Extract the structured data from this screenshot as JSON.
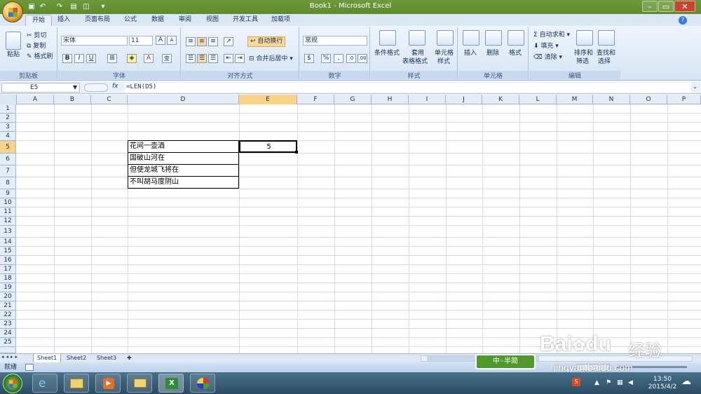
{
  "window": {
    "title": "Book1 - Microsoft Excel"
  },
  "tabs": [
    "开始",
    "插入",
    "页面布局",
    "公式",
    "数据",
    "审阅",
    "视图",
    "开发工具",
    "加载项"
  ],
  "ribbon": {
    "clipboard": {
      "paste": "粘贴",
      "cut": "剪切",
      "copy": "复制",
      "format_painter": "格式刷",
      "label": "剪贴板"
    },
    "font": {
      "name": "宋体",
      "size": "11",
      "bold": "B",
      "italic": "I",
      "underline": "U",
      "grow": "A",
      "shrink": "A",
      "font_color": "A",
      "pinyin": "变",
      "label": "字体"
    },
    "alignment": {
      "wrap": "自动换行",
      "merge": "合并后居中",
      "label": "对齐方式"
    },
    "number": {
      "format": "常规",
      "percent": "%",
      "comma": ",",
      "label": "数字"
    },
    "styles": {
      "conditional": "条件格式",
      "table_line1": "套用",
      "table_line2": "表格格式",
      "cell_line1": "单元格",
      "cell_line2": "样式",
      "label": "样式"
    },
    "cells": {
      "insert": "插入",
      "delete": "删除",
      "format": "格式",
      "label": "单元格"
    },
    "editing": {
      "autosum": "自动求和",
      "fill": "填充",
      "clear": "清除",
      "sort_line1": "排序和",
      "sort_line2": "筛选",
      "find_line1": "查找和",
      "find_line2": "选择",
      "label": "编辑"
    }
  },
  "formula_bar": {
    "name_box": "E5",
    "fx": "fx",
    "formula": "=LEN(D5)"
  },
  "grid": {
    "columns": [
      "A",
      "B",
      "C",
      "D",
      "E",
      "F",
      "G",
      "H",
      "I",
      "J",
      "K",
      "L",
      "M",
      "N",
      "O",
      "P"
    ],
    "selected_column": "E",
    "selected_row": "5",
    "rows": [
      "1",
      "2",
      "3",
      "4",
      "5",
      "6",
      "7",
      "8",
      "9",
      "10",
      "11",
      "12",
      "13",
      "14",
      "15",
      "16",
      "17",
      "18",
      "19",
      "20",
      "21",
      "22",
      "23",
      "24",
      "25"
    ],
    "cells": {
      "D5": "花间一壶酒",
      "D6": "国破山河在",
      "D7": "但使龙城飞将在",
      "D8": "不叫胡马度阴山",
      "E5": "5"
    }
  },
  "sheets": [
    "Sheet1",
    "Sheet2",
    "Sheet3"
  ],
  "status": {
    "ready": "就绪"
  },
  "tray": {
    "time": "13:50",
    "date": "2015/4/2"
  },
  "watermark": {
    "brand": "Bai",
    "brand2": "du",
    "cn": "经验",
    "url": "jingyan.baidu.com",
    "badge": "中◦半简"
  }
}
